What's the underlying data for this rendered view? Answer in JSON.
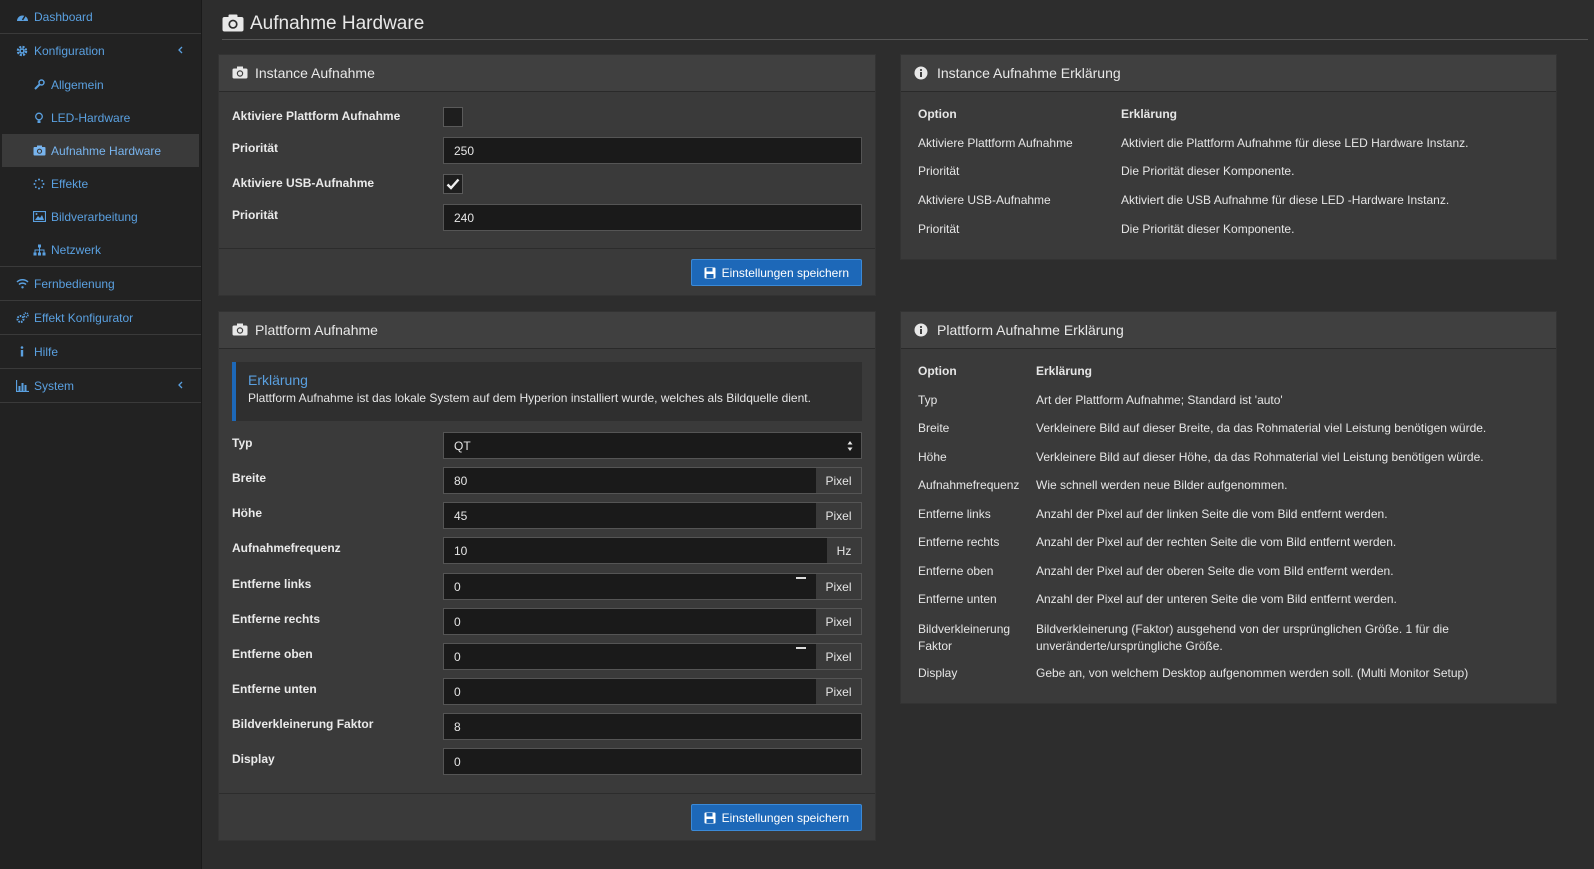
{
  "sidebar": {
    "items": [
      {
        "label": "Dashboard",
        "icon": "dashboard-icon"
      },
      {
        "label": "Konfiguration",
        "icon": "gear-icon",
        "chevron": "chevron-left-icon"
      },
      {
        "label": "Fernbedienung",
        "icon": "wifi-icon"
      },
      {
        "label": "Effekt Konfigurator",
        "icon": "gears-icon"
      },
      {
        "label": "Hilfe",
        "icon": "info-icon"
      },
      {
        "label": "System",
        "icon": "bar-chart-icon",
        "chevron": "chevron-left-icon"
      }
    ],
    "submenu": [
      {
        "label": "Allgemein",
        "icon": "wrench-icon"
      },
      {
        "label": "LED-Hardware",
        "icon": "lightbulb-icon"
      },
      {
        "label": "Aufnahme Hardware",
        "icon": "camera-icon",
        "active": true
      },
      {
        "label": "Effekte",
        "icon": "spinner-icon"
      },
      {
        "label": "Bildverarbeitung",
        "icon": "image-icon"
      },
      {
        "label": "Netzwerk",
        "icon": "sitemap-icon"
      }
    ]
  },
  "page": {
    "title": "Aufnahme Hardware",
    "icon": "camera-icon"
  },
  "instance_panel": {
    "title": "Instance Aufnahme",
    "fields": [
      {
        "label": "Aktiviere Plattform Aufnahme",
        "type": "checkbox",
        "checked": false
      },
      {
        "label": "Priorität",
        "type": "text",
        "value": "250"
      },
      {
        "label": "Aktiviere USB-Aufnahme",
        "type": "checkbox",
        "checked": true
      },
      {
        "label": "Priorität",
        "type": "text",
        "value": "240"
      }
    ],
    "save_label": "Einstellungen speichern"
  },
  "platform_panel": {
    "title": "Plattform Aufnahme",
    "callout_title": "Erklärung",
    "callout_text": "Plattform Aufnahme ist das lokale System auf dem Hyperion installiert wurde, welches als Bildquelle dient.",
    "fields": [
      {
        "label": "Typ",
        "value": "QT",
        "addon": ""
      },
      {
        "label": "Breite",
        "value": "80",
        "addon": "Pixel"
      },
      {
        "label": "Höhe",
        "value": "45",
        "addon": "Pixel"
      },
      {
        "label": "Aufnahmefrequenz",
        "value": "10",
        "addon": "Hz"
      },
      {
        "label": "Entferne links",
        "value": "0",
        "addon": "Pixel"
      },
      {
        "label": "Entferne rechts",
        "value": "0",
        "addon": "Pixel"
      },
      {
        "label": "Entferne oben",
        "value": "0",
        "addon": "Pixel"
      },
      {
        "label": "Entferne unten",
        "value": "0",
        "addon": "Pixel"
      },
      {
        "label": "Bildverkleinerung Faktor",
        "value": "8",
        "addon": ""
      },
      {
        "label": "Display",
        "value": "0",
        "addon": ""
      }
    ],
    "save_label": "Einstellungen speichern"
  },
  "instance_expl": {
    "title": "Instance Aufnahme Erklärung",
    "head": {
      "option": "Option",
      "desc": "Erklärung"
    },
    "rows": [
      {
        "option": "Aktiviere Plattform Aufnahme",
        "desc": "Aktiviert die Plattform Aufnahme für diese LED Hardware Instanz."
      },
      {
        "option": "Priorität",
        "desc": "Die Priorität dieser Komponente."
      },
      {
        "option": "Aktiviere USB-Aufnahme",
        "desc": "Aktiviert die USB Aufnahme für diese LED -Hardware Instanz."
      },
      {
        "option": "Priorität",
        "desc": "Die Priorität dieser Komponente."
      }
    ]
  },
  "platform_expl": {
    "title": "Plattform Aufnahme Erklärung",
    "head": {
      "option": "Option",
      "desc": "Erklärung"
    },
    "rows": [
      {
        "option": "Typ",
        "desc": "Art der Plattform Aufnahme; Standard ist 'auto'"
      },
      {
        "option": "Breite",
        "desc": "Verkleinere Bild auf dieser Breite, da das Rohmaterial viel Leistung benötigen würde."
      },
      {
        "option": "Höhe",
        "desc": "Verkleinere Bild auf dieser Höhe, da das Rohmaterial viel Leistung benötigen würde."
      },
      {
        "option": "Aufnahmefrequenz",
        "desc": "Wie schnell werden neue Bilder aufgenommen."
      },
      {
        "option": "Entferne links",
        "desc": "Anzahl der Pixel auf der linken Seite die vom Bild entfernt werden."
      },
      {
        "option": "Entferne rechts",
        "desc": "Anzahl der Pixel auf der rechten Seite die vom Bild entfernt werden."
      },
      {
        "option": "Entferne oben",
        "desc": "Anzahl der Pixel auf der oberen Seite die vom Bild entfernt werden."
      },
      {
        "option": "Entferne unten",
        "desc": "Anzahl der Pixel auf der unteren Seite die vom Bild entfernt werden."
      },
      {
        "option": "Bildverkleinerung Faktor",
        "desc": "Bildverkleinerung (Faktor) ausgehend von der ursprünglichen Größe. 1 für die unveränderte/ursprüngliche Größe."
      },
      {
        "option": "Display",
        "desc": "Gebe an, von welchem Desktop aufgenommen werden soll. (Multi Monitor Setup)"
      }
    ]
  },
  "colors": {
    "accent": "#1d68b8",
    "link": "#5aa0e0",
    "panel": "#3a3a3a",
    "background": "#2d2d2d"
  }
}
